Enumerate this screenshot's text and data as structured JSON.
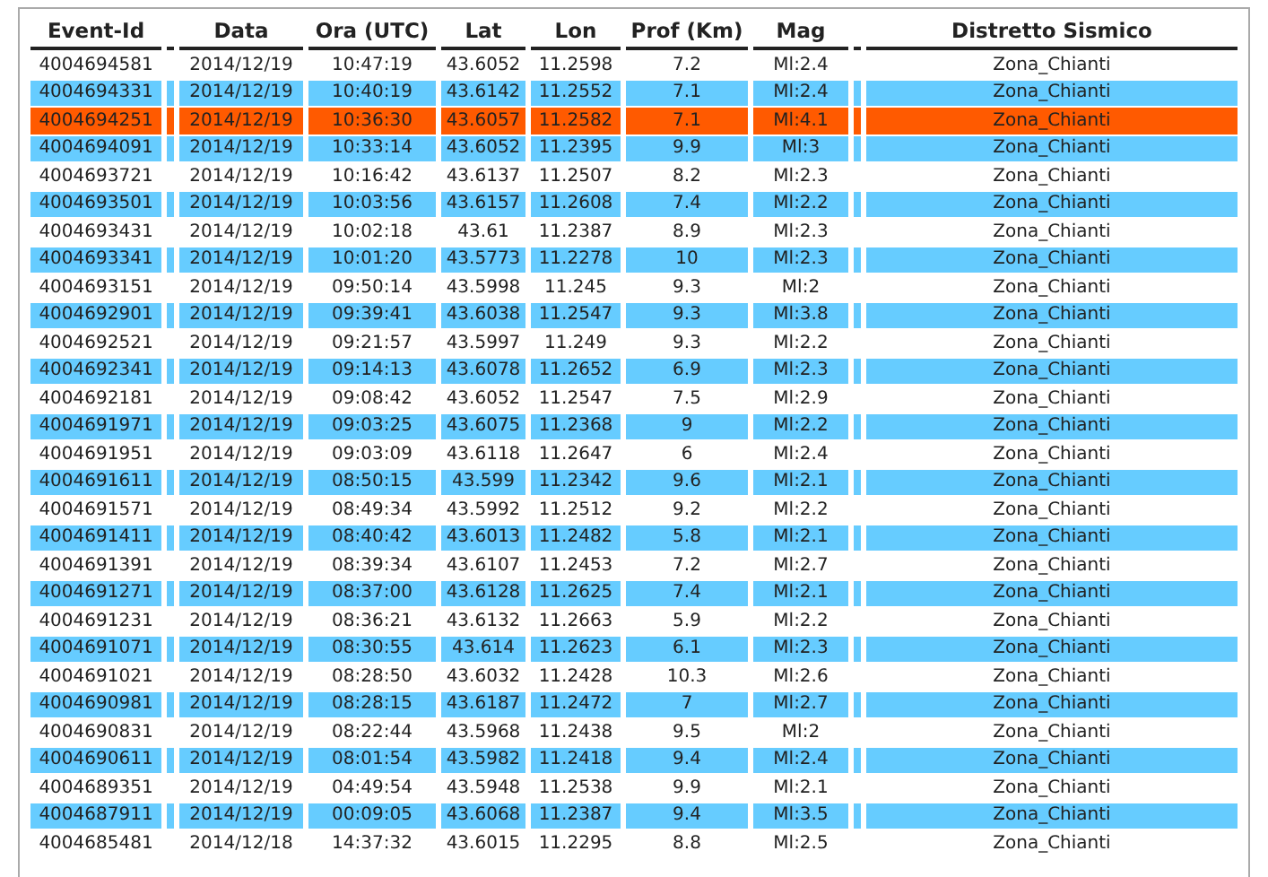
{
  "table": {
    "columns": [
      "Event-Id",
      "Data",
      "Ora (UTC)",
      "Lat",
      "Lon",
      "Prof (Km)",
      "Mag",
      "Distretto Sismico"
    ],
    "rows": [
      {
        "cells": [
          "4004694581",
          "2014/12/19",
          "10:47:19",
          "43.6052",
          "11.2598",
          "7.2",
          "Ml:2.4",
          "Zona_Chianti"
        ]
      },
      {
        "cells": [
          "4004694331",
          "2014/12/19",
          "10:40:19",
          "43.6142",
          "11.2552",
          "7.1",
          "Ml:2.4",
          "Zona_Chianti"
        ],
        "color": "#66ccff"
      },
      {
        "cells": [
          "4004694251",
          "2014/12/19",
          "10:36:30",
          "43.6057",
          "11.2582",
          "7.1",
          "Ml:4.1",
          "Zona_Chianti"
        ],
        "color": "#ff5a00"
      },
      {
        "cells": [
          "4004694091",
          "2014/12/19",
          "10:33:14",
          "43.6052",
          "11.2395",
          "9.9",
          "Ml:3",
          "Zona_Chianti"
        ],
        "color": "#66ccff"
      },
      {
        "cells": [
          "4004693721",
          "2014/12/19",
          "10:16:42",
          "43.6137",
          "11.2507",
          "8.2",
          "Ml:2.3",
          "Zona_Chianti"
        ]
      },
      {
        "cells": [
          "4004693501",
          "2014/12/19",
          "10:03:56",
          "43.6157",
          "11.2608",
          "7.4",
          "Ml:2.2",
          "Zona_Chianti"
        ],
        "color": "#66ccff"
      },
      {
        "cells": [
          "4004693431",
          "2014/12/19",
          "10:02:18",
          "43.61",
          "11.2387",
          "8.9",
          "Ml:2.3",
          "Zona_Chianti"
        ]
      },
      {
        "cells": [
          "4004693341",
          "2014/12/19",
          "10:01:20",
          "43.5773",
          "11.2278",
          "10",
          "Ml:2.3",
          "Zona_Chianti"
        ],
        "color": "#66ccff"
      },
      {
        "cells": [
          "4004693151",
          "2014/12/19",
          "09:50:14",
          "43.5998",
          "11.245",
          "9.3",
          "Ml:2",
          "Zona_Chianti"
        ]
      },
      {
        "cells": [
          "4004692901",
          "2014/12/19",
          "09:39:41",
          "43.6038",
          "11.2547",
          "9.3",
          "Ml:3.8",
          "Zona_Chianti"
        ],
        "color": "#66ccff"
      },
      {
        "cells": [
          "4004692521",
          "2014/12/19",
          "09:21:57",
          "43.5997",
          "11.249",
          "9.3",
          "Ml:2.2",
          "Zona_Chianti"
        ]
      },
      {
        "cells": [
          "4004692341",
          "2014/12/19",
          "09:14:13",
          "43.6078",
          "11.2652",
          "6.9",
          "Ml:2.3",
          "Zona_Chianti"
        ],
        "color": "#66ccff"
      },
      {
        "cells": [
          "4004692181",
          "2014/12/19",
          "09:08:42",
          "43.6052",
          "11.2547",
          "7.5",
          "Ml:2.9",
          "Zona_Chianti"
        ]
      },
      {
        "cells": [
          "4004691971",
          "2014/12/19",
          "09:03:25",
          "43.6075",
          "11.2368",
          "9",
          "Ml:2.2",
          "Zona_Chianti"
        ],
        "color": "#66ccff"
      },
      {
        "cells": [
          "4004691951",
          "2014/12/19",
          "09:03:09",
          "43.6118",
          "11.2647",
          "6",
          "Ml:2.4",
          "Zona_Chianti"
        ]
      },
      {
        "cells": [
          "4004691611",
          "2014/12/19",
          "08:50:15",
          "43.599",
          "11.2342",
          "9.6",
          "Ml:2.1",
          "Zona_Chianti"
        ],
        "color": "#66ccff"
      },
      {
        "cells": [
          "4004691571",
          "2014/12/19",
          "08:49:34",
          "43.5992",
          "11.2512",
          "9.2",
          "Ml:2.2",
          "Zona_Chianti"
        ]
      },
      {
        "cells": [
          "4004691411",
          "2014/12/19",
          "08:40:42",
          "43.6013",
          "11.2482",
          "5.8",
          "Ml:2.1",
          "Zona_Chianti"
        ],
        "color": "#66ccff"
      },
      {
        "cells": [
          "4004691391",
          "2014/12/19",
          "08:39:34",
          "43.6107",
          "11.2453",
          "7.2",
          "Ml:2.7",
          "Zona_Chianti"
        ]
      },
      {
        "cells": [
          "4004691271",
          "2014/12/19",
          "08:37:00",
          "43.6128",
          "11.2625",
          "7.4",
          "Ml:2.1",
          "Zona_Chianti"
        ],
        "color": "#66ccff"
      },
      {
        "cells": [
          "4004691231",
          "2014/12/19",
          "08:36:21",
          "43.6132",
          "11.2663",
          "5.9",
          "Ml:2.2",
          "Zona_Chianti"
        ]
      },
      {
        "cells": [
          "4004691071",
          "2014/12/19",
          "08:30:55",
          "43.614",
          "11.2623",
          "6.1",
          "Ml:2.3",
          "Zona_Chianti"
        ],
        "color": "#66ccff"
      },
      {
        "cells": [
          "4004691021",
          "2014/12/19",
          "08:28:50",
          "43.6032",
          "11.2428",
          "10.3",
          "Ml:2.6",
          "Zona_Chianti"
        ]
      },
      {
        "cells": [
          "4004690981",
          "2014/12/19",
          "08:28:15",
          "43.6187",
          "11.2472",
          "7",
          "Ml:2.7",
          "Zona_Chianti"
        ],
        "color": "#66ccff"
      },
      {
        "cells": [
          "4004690831",
          "2014/12/19",
          "08:22:44",
          "43.5968",
          "11.2438",
          "9.5",
          "Ml:2",
          "Zona_Chianti"
        ]
      },
      {
        "cells": [
          "4004690611",
          "2014/12/19",
          "08:01:54",
          "43.5982",
          "11.2418",
          "9.4",
          "Ml:2.4",
          "Zona_Chianti"
        ],
        "color": "#66ccff"
      },
      {
        "cells": [
          "4004689351",
          "2014/12/19",
          "04:49:54",
          "43.5948",
          "11.2538",
          "9.9",
          "Ml:2.1",
          "Zona_Chianti"
        ]
      },
      {
        "cells": [
          "4004687911",
          "2014/12/19",
          "00:09:05",
          "43.6068",
          "11.2387",
          "9.4",
          "Ml:3.5",
          "Zona_Chianti"
        ],
        "color": "#66ccff"
      },
      {
        "cells": [
          "4004685481",
          "2014/12/18",
          "14:37:32",
          "43.6015",
          "11.2295",
          "8.8",
          "Ml:2.5",
          "Zona_Chianti"
        ]
      }
    ]
  }
}
